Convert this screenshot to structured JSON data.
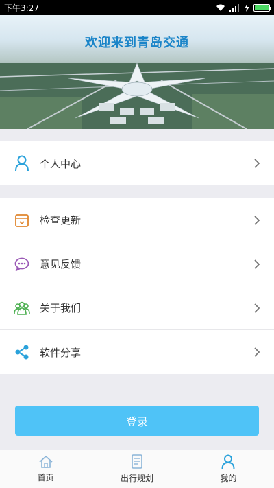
{
  "status": {
    "time": "下午3:27"
  },
  "banner": {
    "title": "欢迎来到青岛交通"
  },
  "menu": {
    "profile": {
      "label": "个人中心",
      "icon": "person-icon"
    },
    "items": [
      {
        "label": "检查更新",
        "icon": "update-box-icon"
      },
      {
        "label": "意见反馈",
        "icon": "chat-bubble-icon"
      },
      {
        "label": "关于我们",
        "icon": "group-icon"
      },
      {
        "label": "软件分享",
        "icon": "share-icon"
      }
    ]
  },
  "login": {
    "label": "登录"
  },
  "tabs": [
    {
      "label": "首页",
      "icon": "home-icon"
    },
    {
      "label": "出行规划",
      "icon": "document-icon"
    },
    {
      "label": "我的",
      "icon": "person-icon",
      "active": true
    }
  ],
  "colors": {
    "accent": "#4fc3f7",
    "title": "#1a84c8",
    "icon_blue": "#2aa2db",
    "icon_orange": "#e0862e",
    "icon_purple": "#9b59b6",
    "icon_green": "#4caf50"
  }
}
